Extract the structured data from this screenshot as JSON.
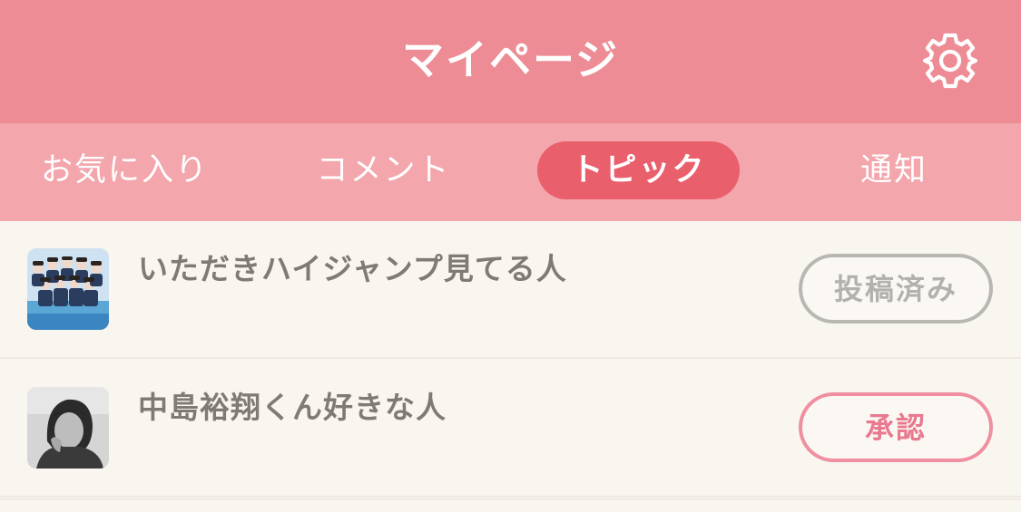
{
  "header": {
    "title": "マイページ",
    "settings_icon": "gear-icon"
  },
  "tabs": [
    {
      "label": "お気に入り",
      "active": false
    },
    {
      "label": "コメント",
      "active": false
    },
    {
      "label": "トピック",
      "active": true
    },
    {
      "label": "通知",
      "active": false
    }
  ],
  "topics": [
    {
      "title": "いただきハイジャンプ見てる人",
      "status": "投稿済み",
      "status_type": "posted"
    },
    {
      "title": "中島裕翔くん好きな人",
      "status": "承認",
      "status_type": "approve"
    }
  ],
  "colors": {
    "header_bg": "#ee8c95",
    "tab_bar_bg": "#f3a6ac",
    "active_tab_bg": "#ea5f6c",
    "page_bg": "#f9f5ef"
  }
}
